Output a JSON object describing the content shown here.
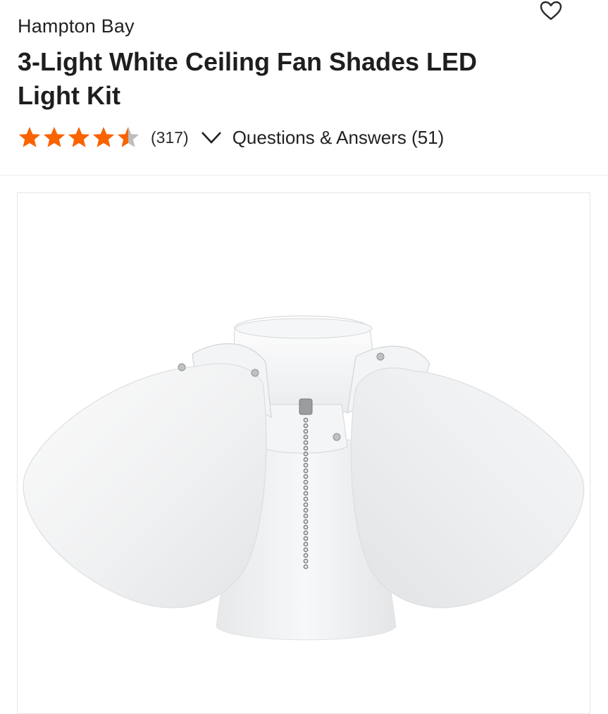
{
  "product": {
    "brand": "Hampton Bay",
    "title": "3-Light White Ceiling Fan Shades LED Light Kit",
    "rating": 4.5,
    "rating_max": 5,
    "review_count_label": "(317)",
    "qa_label": "Questions & Answers (51)"
  },
  "colors": {
    "star": "#f96302",
    "star_empty": "#bdbdbd",
    "text": "#1e1e1e"
  },
  "icons": {
    "favorite": "heart-outline-icon",
    "expand": "chevron-down-icon",
    "rating": "star-icon"
  }
}
